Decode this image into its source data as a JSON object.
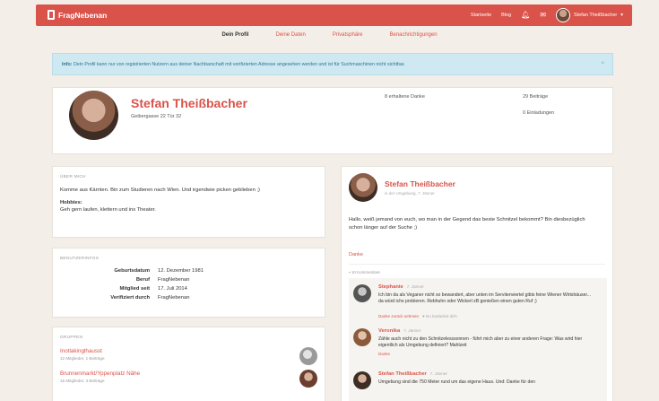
{
  "nav": {
    "brand": "FragNebenan",
    "links": [
      "Startseite",
      "Blog"
    ],
    "bell_icon": "bell-icon",
    "mail_icon": "mail-icon",
    "user": "Stefan Theißbacher",
    "caret": "▾"
  },
  "tabs": [
    "Dein Profil",
    "Deine Daten",
    "Privatsphäre",
    "Benachrichtigungen"
  ],
  "infobar": {
    "prefix": "Info:",
    "text": "Dein Profil kann nur von registrierten Nutzern aus deiner Nachbarschaft mit verifizierten Adresse angesehen werden und ist für Suchmaschinen nicht sichtbar.",
    "close": "×"
  },
  "profile": {
    "name": "Stefan Theißbacher",
    "address": "Geibergasse 22 Tür 32",
    "stats": [
      "8 erhaltene Danke",
      "29 Beiträge",
      "0 Einladungen"
    ]
  },
  "about": {
    "title": "ÜBER MICH",
    "text": "Komme aus Kärnten. Bin zum Studieren nach Wien. Und irgendwie picken geblieben ;)",
    "hobbies_label": "Hobbies:",
    "hobbies": "Geh gern laufen, klettern und ins Theater."
  },
  "userinfo": {
    "title": "BENUTZERINFOS",
    "rows": [
      {
        "key": "Geburtsdatum",
        "value": "12. Dezember 1981"
      },
      {
        "key": "Beruf",
        "value": "FragNebenan"
      },
      {
        "key": "Mitglied seit",
        "value": "17. Juli 2014"
      },
      {
        "key": "Verifiziert durch",
        "value": "FragNebenan"
      }
    ]
  },
  "groups": {
    "title": "GRUPPEN",
    "items": [
      {
        "name": "Inotlakinglhausst",
        "meta": "12 Mitglieder, 1 Beiträge"
      },
      {
        "name": "Brunnenmarkt/Yppenplatz Nähe",
        "meta": "15 Mitglieder, 3 Beiträge"
      }
    ]
  },
  "post": {
    "author": "Stefan Theißbacher",
    "sub": "in der Umgebung, 7. Jänner",
    "text": "Hallo, weiß jemand von euch, wo man in der Gegend das beste Schnitzel bekommt? Bin diesbezüglich schon länger auf der Suche ;)",
    "thanks": "Danke",
    "comment_count": "10 Kommentare",
    "comments": [
      {
        "author": "Stephanie",
        "date": "7. Jänner",
        "text": "Ich bin da als Veganer nicht so bewandert, aber unten im Servitenviertel gibts feine Wiener Wirtshäuser... da würd ichs probieren. Rebhuhn oder Wickerl zB genießen einen guten Ruf ;)",
        "action": "Danke zurück nehmen",
        "note": "Du bedankst dich"
      },
      {
        "author": "Veronika",
        "date": "7. Jänner",
        "text": "Zähle auch nicht zu den Schnitzelesssonnen - führt mich aber zu einer anderen Frage: Was wird hier eigentlich als Umgebung definiert? Mahlzeit",
        "action": "Danke",
        "note": ""
      },
      {
        "author": "Stefan Theißbacher",
        "date": "7. Jänner",
        "text": "Umgebung sind die 750 Meter rund um das eigene Haus. Und: Danke für den",
        "action": "",
        "note": ""
      }
    ]
  }
}
